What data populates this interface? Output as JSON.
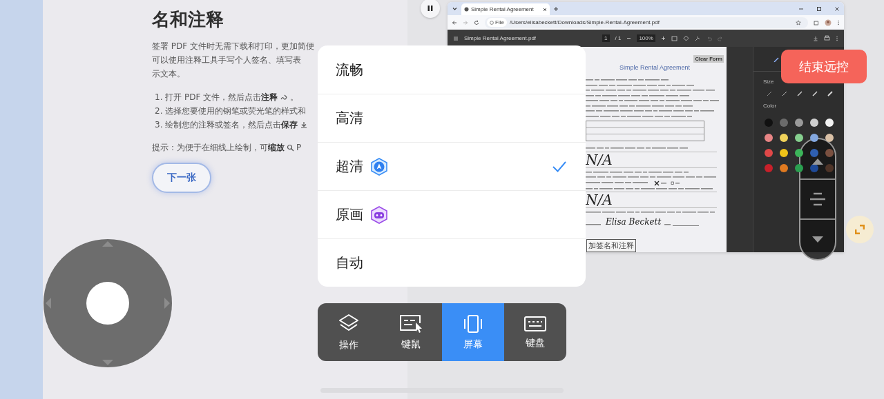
{
  "remote_screen": {
    "article": {
      "title_lines": [
        "名和注释"
      ],
      "paragraph_lines": [
        "签署 PDF 文件时无需下载和打印，更加简便",
        "可以使用注释工具手写个人签名、填写表",
        "示文本。"
      ],
      "steps": [
        {
          "text": "1. 打开 PDF 文件，然后点击**注释**",
          "kind": "annotate",
          "tail": "。"
        },
        {
          "text": "2. 选择您要使用的钢笔或荧光笔的样式和",
          "kind": "plain"
        },
        {
          "text": "3. 绘制您的注释或签名，然后点击**保存**",
          "kind": "save"
        }
      ],
      "tip": {
        "text": "提示：为便于在细线上绘制，可**缩放**",
        "kind": "zoom",
        "tail": "P"
      },
      "next_button": "下一张"
    },
    "browser": {
      "tab_title": "Simple Rental Agreement",
      "address_chip": "File",
      "url": "/Users/elisabeckett/Downloads/Simple-Rental-Agreement.pdf",
      "pdf_toolbar": {
        "file_name": "Simple Rental Agreement.pdf",
        "page": "1",
        "page_total": "/ 1",
        "zoom": "100%"
      },
      "document": {
        "clear_button": "Clear Form",
        "title": "Simple Rental Agreement",
        "sections": [
          {
            "kind": "form_text"
          },
          {
            "kind": "form_text"
          },
          {
            "kind": "form_text"
          },
          {
            "kind": "form_text"
          },
          {
            "kind": "form_text"
          },
          {
            "kind": "form_text"
          },
          {
            "kind": "form_text"
          },
          {
            "kind": "form_text"
          },
          {
            "kind": "box"
          },
          {
            "kind": "form_text"
          },
          {
            "kind": "handwriting",
            "text": "N/A"
          },
          {
            "kind": "form_text"
          },
          {
            "kind": "form_text"
          },
          {
            "kind": "check_row"
          },
          {
            "kind": "form_text"
          },
          {
            "kind": "handwriting",
            "text": "N/A"
          },
          {
            "kind": "form_text"
          },
          {
            "kind": "signature",
            "text": "Elisa Beckett"
          }
        ],
        "caption": "加签名和注释"
      },
      "annotation_panel": {
        "size_label": "Size",
        "color_label": "Color",
        "colors": [
          {
            "color": "#111111"
          },
          {
            "color": "#6b6b6b"
          },
          {
            "color": "#9a9a9a"
          },
          {
            "color": "#cfcfcf"
          },
          {
            "color": "#f2f2f2"
          },
          {
            "color": "#e88585"
          },
          {
            "color": "#f0d25a"
          },
          {
            "color": "#86d08f"
          },
          {
            "color": "#84a8e0"
          },
          {
            "color": "#d9c0a6"
          },
          {
            "color": "#e04848"
          },
          {
            "color": "#f0c419"
          },
          {
            "color": "#3cb55a"
          },
          {
            "color": "#2f5fb0"
          },
          {
            "color": "#7a5040"
          },
          {
            "color": "#c8202a"
          },
          {
            "color": "#e07a20"
          },
          {
            "color": "#2aa050"
          },
          {
            "color": "#1f4a98"
          },
          {
            "color": "#4e3428"
          }
        ]
      }
    }
  },
  "quality_menu": [
    {
      "label": "流畅",
      "selected": false,
      "kind": "plain"
    },
    {
      "label": "高清",
      "selected": false,
      "kind": "plain"
    },
    {
      "label": "超清",
      "selected": true,
      "kind": "vip"
    },
    {
      "label": "原画",
      "selected": false,
      "kind": "game"
    },
    {
      "label": "自动",
      "selected": false,
      "kind": "plain"
    }
  ],
  "toolbar": [
    {
      "label": "操作",
      "kind": "layers",
      "selected": false
    },
    {
      "label": "键鼠",
      "kind": "mouse",
      "selected": false
    },
    {
      "label": "屏幕",
      "kind": "screen",
      "selected": true
    },
    {
      "label": "键盘",
      "kind": "keyboard",
      "selected": false
    }
  ],
  "end_button": "结束远控"
}
